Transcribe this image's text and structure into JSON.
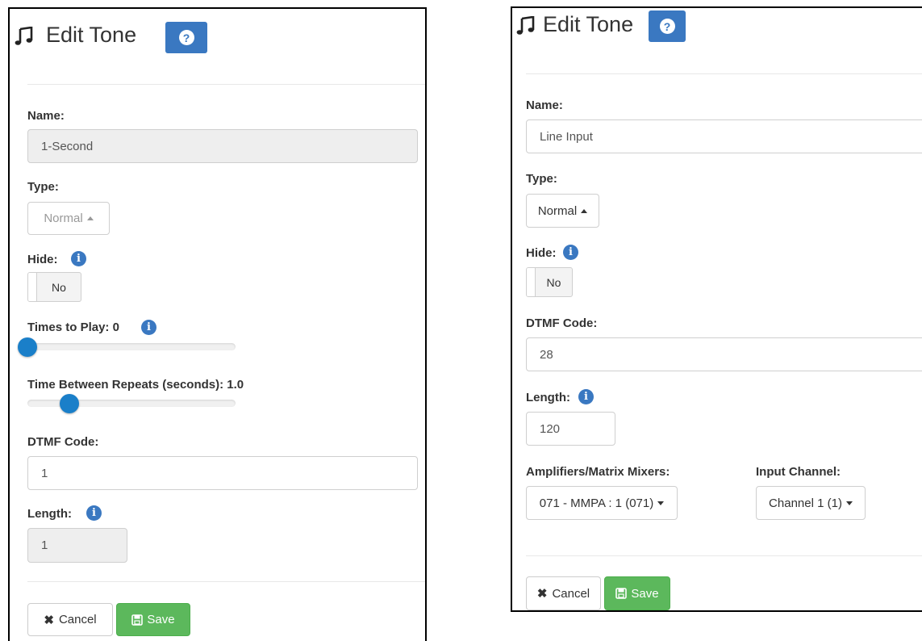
{
  "left": {
    "title": "Edit Tone",
    "name_label": "Name:",
    "name_value": "1-Second",
    "type_label": "Type:",
    "type_value": "Normal",
    "hide_label": "Hide:",
    "hide_value": "No",
    "times_label": "Times to Play: 0",
    "times_value": 0,
    "repeat_label": "Time Between Repeats (seconds): 1.0",
    "repeat_fraction": 0.2,
    "dtmf_label": "DTMF Code:",
    "dtmf_value": "1",
    "length_label": "Length:",
    "length_value": "1",
    "cancel_label": "Cancel",
    "save_label": "Save"
  },
  "right": {
    "title": "Edit Tone",
    "name_label": "Name:",
    "name_value": "Line Input",
    "type_label": "Type:",
    "type_value": "Normal",
    "hide_label": "Hide:",
    "hide_value": "No",
    "dtmf_label": "DTMF Code:",
    "dtmf_value": "28",
    "length_label": "Length:",
    "length_value": "120",
    "amp_label": "Amplifiers/Matrix Mixers:",
    "amp_value": "071 - MMPA : 1 (071)",
    "channel_label": "Input Channel:",
    "channel_value": "Channel 1 (1)",
    "cancel_label": "Cancel",
    "save_label": "Save"
  },
  "icons": {
    "help": "?",
    "info": "i"
  },
  "colors": {
    "primary": "#3a78c1",
    "slider": "#1a7fc9",
    "save": "#5cb85c"
  }
}
